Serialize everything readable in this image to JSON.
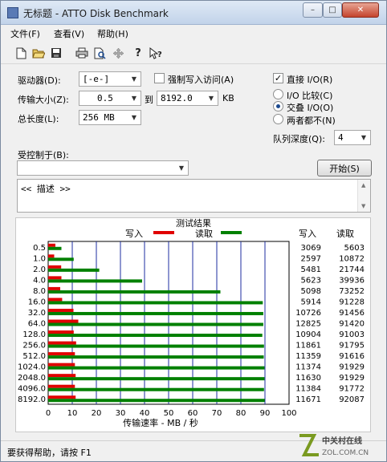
{
  "window": {
    "title": "无标题 - ATTO Disk Benchmark",
    "minimize": "–",
    "maximize": "□",
    "close": "✕"
  },
  "menu": {
    "file": "文件(F)",
    "view": "查看(V)",
    "help": "帮助(H)"
  },
  "toolbar": {
    "icons": [
      "new-icon",
      "open-icon",
      "save-icon",
      "print-icon",
      "print-preview-icon",
      "move-icon",
      "help-icon",
      "context-help-icon"
    ]
  },
  "form": {
    "drive_label": "驱动器(D):",
    "drive_value": "[-e-]",
    "transfer_label": "传输大小(Z):",
    "transfer_from": "0.5",
    "transfer_to_label": "到",
    "transfer_to": "8192.0",
    "transfer_unit": "KB",
    "length_label": "总长度(L):",
    "length_value": "256 MB",
    "force_write_label": "强制写入访问(A)",
    "force_write_checked": false,
    "direct_io_label": "直接 I/O(R)",
    "direct_io_checked": true,
    "radio_compare": "I/O 比较(C)",
    "radio_overlap": "交叠 I/O(O)",
    "radio_neither": "两者都不(N)",
    "radio_selected": "overlap",
    "queue_label": "队列深度(Q):",
    "queue_value": "4",
    "controlled_label": "受控制于(B):",
    "controlled_value": "",
    "start_button": "开始(S)",
    "description": "<< 描述 >>"
  },
  "status": {
    "text": "要获得帮助，请按 F1"
  },
  "watermark": {
    "text": "中关村在线",
    "subtext": "ZOL.COM.CN"
  },
  "chart_data": {
    "type": "bar",
    "orientation": "horizontal",
    "title": "测试结果",
    "xlabel": "传输速率 - MB / 秒",
    "xlim": [
      0,
      100
    ],
    "xticks": [
      0,
      10,
      20,
      30,
      40,
      50,
      60,
      70,
      80,
      90,
      100
    ],
    "grid": true,
    "legend_position": "top",
    "col_write_label": "写入",
    "col_read_label": "读取",
    "categories": [
      "0.5",
      "1.0",
      "2.0",
      "4.0",
      "8.0",
      "16.0",
      "32.0",
      "64.0",
      "128.0",
      "256.0",
      "512.0",
      "1024.0",
      "2048.0",
      "4096.0",
      "8192.0"
    ],
    "series": [
      {
        "name": "写入",
        "color": "#e00000",
        "values": [
          3.0,
          2.5,
          5.4,
          5.5,
          5.0,
          5.8,
          10.5,
          12.5,
          10.6,
          11.6,
          11.1,
          11.1,
          11.4,
          11.1,
          11.4
        ]
      },
      {
        "name": "读取",
        "color": "#008000",
        "values": [
          5.5,
          10.6,
          21.2,
          39.0,
          71.5,
          89.1,
          89.3,
          89.3,
          88.9,
          89.6,
          89.5,
          89.8,
          89.8,
          89.6,
          89.9
        ]
      }
    ],
    "write_readouts": [
      "3069",
      "2597",
      "5481",
      "5623",
      "5098",
      "5914",
      "10726",
      "12825",
      "10904",
      "11861",
      "11359",
      "11374",
      "11630",
      "11384",
      "11671"
    ],
    "read_readouts": [
      "5603",
      "10872",
      "21744",
      "39936",
      "73252",
      "91228",
      "91456",
      "91420",
      "91003",
      "91795",
      "91616",
      "91929",
      "91929",
      "91772",
      "92087"
    ]
  }
}
